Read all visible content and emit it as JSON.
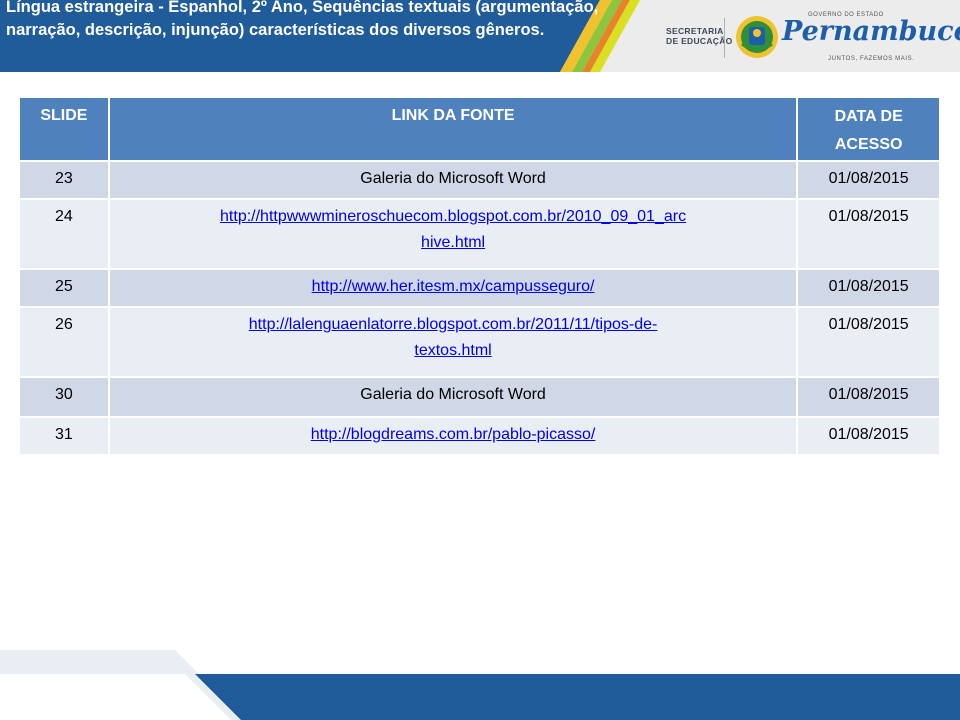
{
  "header": {
    "title": "Língua estrangeira - Espanhol, 2º Ano, Sequências textuais (argumentação, narração, descrição, injunção) características dos diversos gêneros.",
    "secretaria_line1": "SECRETARIA",
    "secretaria_line2": "DE EDUCAÇÃO",
    "gov_label": "GOVERNO DO ESTADO",
    "brand": "Pernambuco",
    "slogan": "JUNTOS, FAZEMOS MAIS."
  },
  "table": {
    "headers": {
      "slide": "SLIDE",
      "link": "LINK DA FONTE",
      "date_line1": "DATA DE",
      "date_line2": "ACESSO"
    },
    "rows": [
      {
        "slide": "23",
        "link": "Galeria do Microsoft Word",
        "date": "01/08/2015"
      },
      {
        "slide": "24",
        "link_line1": "http://httpwwwmineroschuecom.blogspot.com.br/2010_09_01_arc",
        "link_line2": "hive.html",
        "date": "01/08/2015"
      },
      {
        "slide": "25",
        "link": "http://www.her.itesm.mx/campusseguro/",
        "date": "01/08/2015"
      },
      {
        "slide": "26",
        "link_line1": "http://lalenguaenlatorre.blogspot.com.br/2011/11/tipos-de-",
        "link_line2": "textos.html",
        "date": "01/08/2015"
      },
      {
        "slide": "30",
        "link": "Galeria do Microsoft Word",
        "date": "01/08/2015"
      },
      {
        "slide": "31",
        "link": "http://blogdreams.com.br/pablo-picasso/",
        "date": "01/08/2015"
      }
    ]
  },
  "colors": {
    "header_blue": "#1f5c99",
    "table_header": "#4f81bd",
    "row_odd": "#d0d8e8",
    "row_even": "#e9edf4",
    "link": "#0000ee",
    "footer_blue": "#1f5c99"
  }
}
